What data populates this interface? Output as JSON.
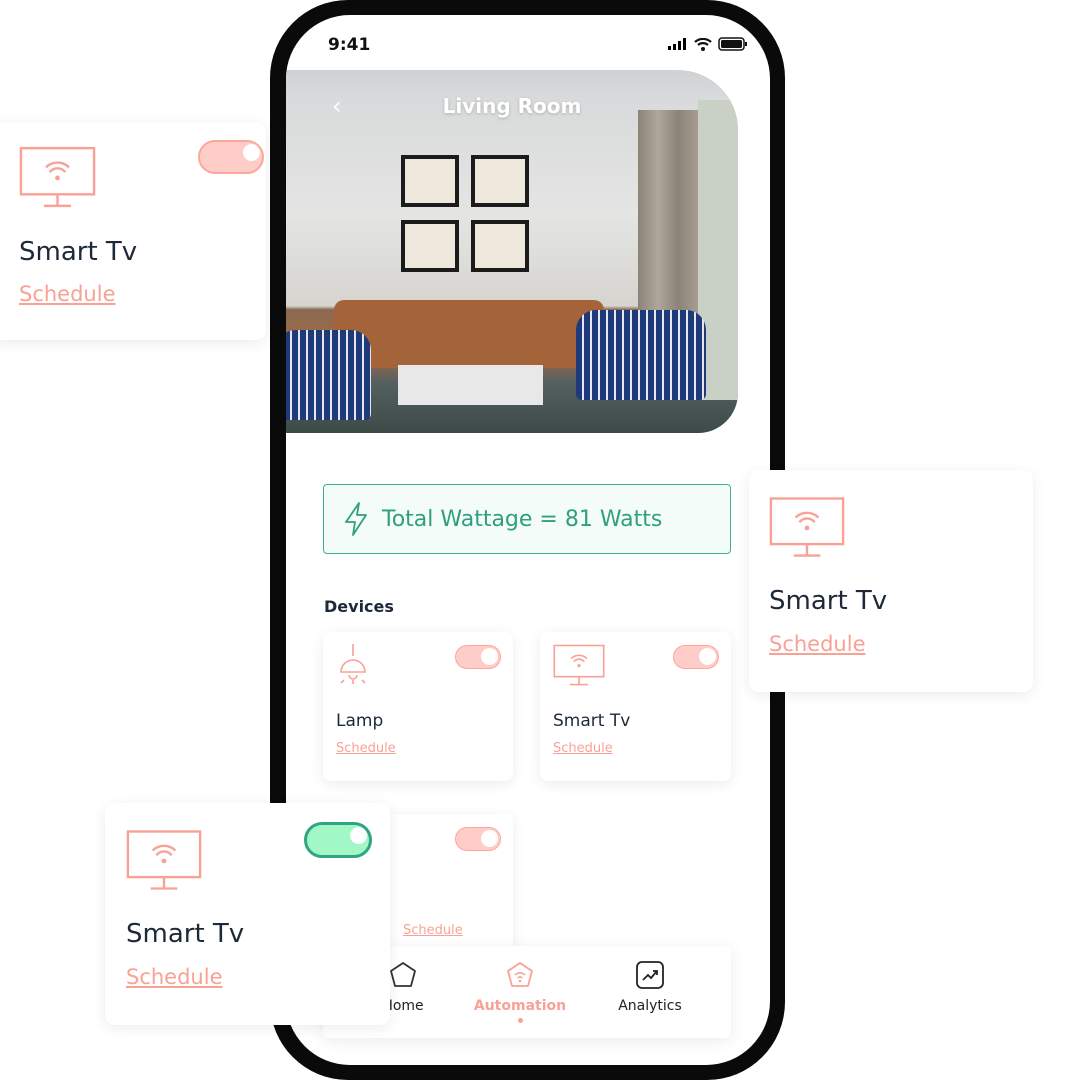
{
  "status": {
    "time": "9:41"
  },
  "header": {
    "title": "Living Room",
    "back_icon": "chevron-left-icon"
  },
  "wattage": {
    "text": "Total Wattage = 81 Watts",
    "icon": "lightning-icon"
  },
  "devices": {
    "title": "Devices",
    "items": [
      {
        "name": "Lamp",
        "link": "Schedule",
        "icon": "lamp-icon",
        "on": true
      },
      {
        "name": "Smart Tv",
        "link": "Schedule",
        "icon": "tv-wifi-icon",
        "on": true
      },
      {
        "name": "",
        "link": "Schedule",
        "icon": "tv-wifi-icon",
        "on": true
      }
    ]
  },
  "nav": {
    "items": [
      {
        "label": "Home",
        "icon": "home-icon"
      },
      {
        "label": "Automation",
        "icon": "automation-icon",
        "active": true
      },
      {
        "label": "Analytics",
        "icon": "analytics-icon"
      }
    ]
  },
  "floating_cards": [
    {
      "name": "Smart Tv",
      "link": "Schedule",
      "on": false
    },
    {
      "name": "Smart Tv",
      "link": "Schedule"
    },
    {
      "name": "Smart Tv",
      "link": "Schedule",
      "on": true
    }
  ],
  "colors": {
    "accent": "#f9a195",
    "green": "#31a583",
    "text": "#1d2939"
  }
}
